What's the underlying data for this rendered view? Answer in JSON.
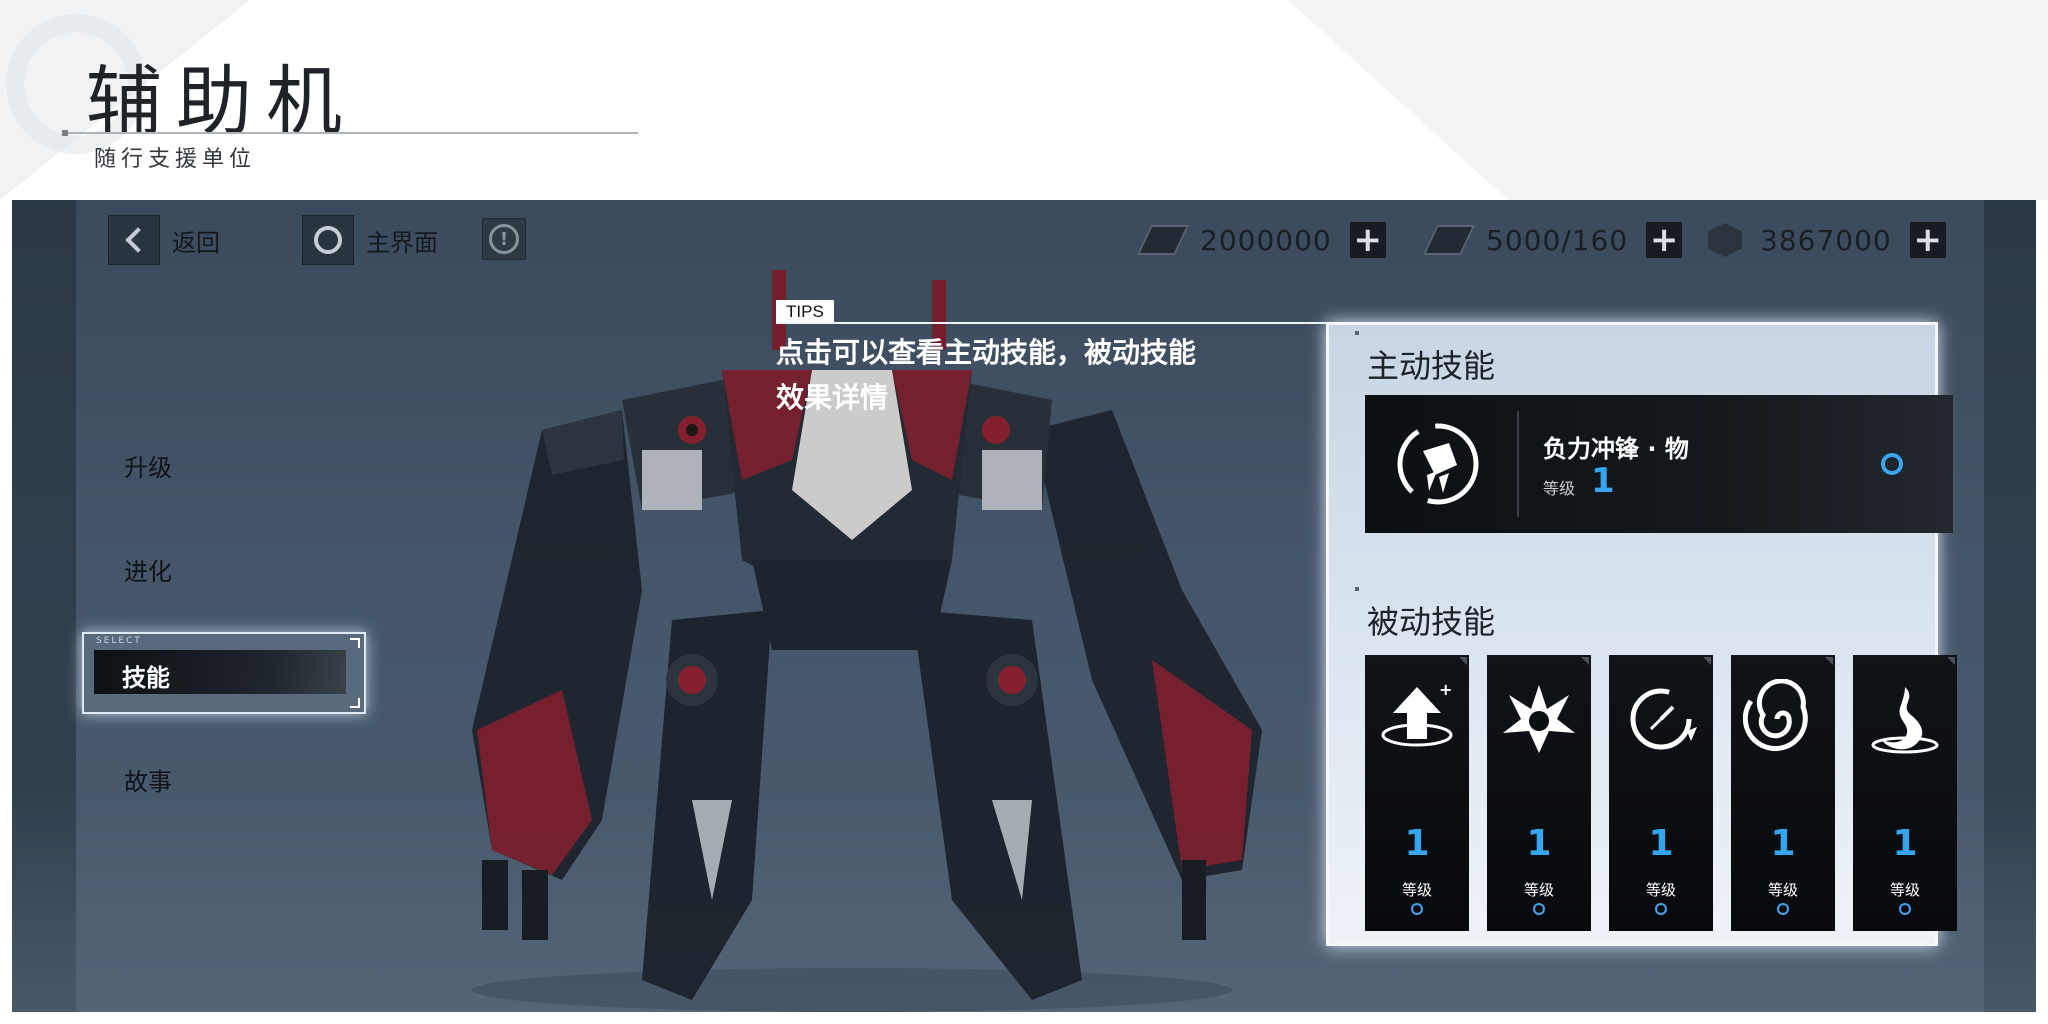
{
  "header": {
    "title": "辅助机",
    "subtitle": "随行支援单位"
  },
  "topbar": {
    "back_label": "返回",
    "home_label": "主界面",
    "info_icon": "info-icon",
    "currencies": [
      {
        "icon": "ticket-icon",
        "value": "2000000"
      },
      {
        "icon": "battery-icon",
        "value": "5000/160"
      },
      {
        "icon": "crystal-icon",
        "value": "3867000"
      }
    ]
  },
  "menu": {
    "items": [
      {
        "label": "升级",
        "selected": false
      },
      {
        "label": "进化",
        "selected": false
      },
      {
        "label": "技能",
        "selected": true
      },
      {
        "label": "故事",
        "selected": false
      }
    ],
    "select_tag": "SELECT"
  },
  "tips": {
    "tag": "TIPS",
    "text": "点击可以查看主动技能，被动技能效果详情"
  },
  "active_skill": {
    "heading": "主动技能",
    "name": "负力冲锋 · 物",
    "level_label": "等级",
    "level": "1",
    "icon": "charge-fist-icon"
  },
  "passive_skills": {
    "heading": "被动技能",
    "items": [
      {
        "icon": "upgrade-arrow-icon",
        "level": "1",
        "level_label": "等级"
      },
      {
        "icon": "burst-icon",
        "level": "1",
        "level_label": "等级"
      },
      {
        "icon": "clock-cooldown-icon",
        "level": "1",
        "level_label": "等级"
      },
      {
        "icon": "vortex-icon",
        "level": "1",
        "level_label": "等级"
      },
      {
        "icon": "flame-swirl-icon",
        "level": "1",
        "level_label": "等级"
      }
    ]
  },
  "colors": {
    "accent_blue": "#36a5f0",
    "mech_red": "#8c1f2e",
    "panel_bg": "#d9e3ee",
    "scene_bg": "#45566a"
  }
}
